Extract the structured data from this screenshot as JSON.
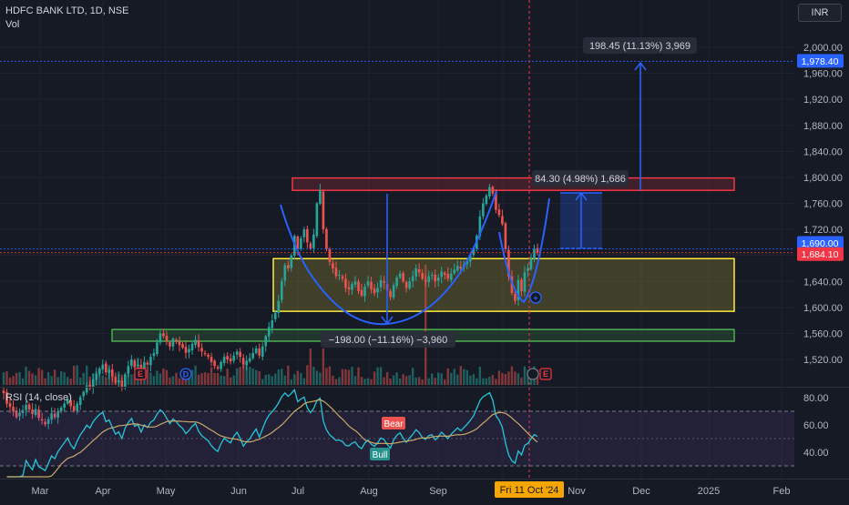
{
  "header": {
    "symbol_line": "HDFC BANK LTD, 1D, NSE",
    "volume_label": "Vol",
    "currency": "INR"
  },
  "rsi": {
    "label": "RSI (14, close)",
    "levels": [
      80.0,
      60.0,
      40.0
    ],
    "overbought": 70,
    "oversold": 30
  },
  "chart_data": [
    {
      "type": "candlestick",
      "title": "HDFC BANK LTD, 1D, NSE",
      "ylim": [
        1500,
        2030
      ],
      "y_ticks": [
        "1,520.00",
        "1,560.00",
        "1,600.00",
        "1,640.00",
        "1,680.00",
        "1,720.00",
        "1,760.00",
        "1,800.00",
        "1,840.00",
        "1,880.00",
        "1,920.00",
        "1,960.00",
        "2,000.00"
      ],
      "x_ticks": [
        "Mar",
        "Apr",
        "May",
        "Jun",
        "Jul",
        "Aug",
        "Sep",
        "Oct",
        "Nov",
        "Dec",
        "2025",
        "Feb"
      ],
      "price_labels": [
        {
          "value": 1978.4,
          "text": "1,978.40",
          "color": "#2962ff"
        },
        {
          "value": 1690.0,
          "text": "1,690.00",
          "color": "#2962ff"
        },
        {
          "value": 1684.1,
          "text": "1,684.10",
          "color": "#f23645"
        }
      ],
      "crosshair_date": "Fri 11 Oct '24",
      "zones": [
        {
          "name": "resistance",
          "from": 1780,
          "to": 1799,
          "color": "#f23645"
        },
        {
          "name": "range",
          "from": 1594,
          "to": 1675,
          "color": "#ffeb3b"
        },
        {
          "name": "support",
          "from": 1548,
          "to": 1566,
          "color": "#4caf50"
        }
      ],
      "annotations": [
        {
          "text": "198.45 (11.13%) 3,969"
        },
        {
          "text": "84.30 (4.98%) 1,686"
        },
        {
          "text": "−198.00 (−11.16%) −3,960"
        }
      ],
      "closes": [
        1468,
        1452,
        1447,
        1440,
        1431,
        1438,
        1442,
        1450,
        1443,
        1436,
        1444,
        1430,
        1426,
        1420,
        1428,
        1437,
        1431,
        1440,
        1446,
        1452,
        1459,
        1448,
        1441,
        1452,
        1462,
        1470,
        1480,
        1476,
        1489,
        1498,
        1506,
        1512,
        1500,
        1504,
        1494,
        1484,
        1488,
        1478,
        1497,
        1510,
        1520,
        1508,
        1512,
        1500,
        1516,
        1512,
        1524,
        1530,
        1546,
        1560,
        1556,
        1548,
        1540,
        1552,
        1548,
        1542,
        1538,
        1530,
        1536,
        1544,
        1550,
        1539,
        1532,
        1528,
        1524,
        1516,
        1510,
        1506,
        1516,
        1524,
        1520,
        1517,
        1526,
        1532,
        1524,
        1512,
        1518,
        1522,
        1530,
        1537,
        1526,
        1540,
        1556,
        1570,
        1580,
        1592,
        1610,
        1640,
        1665,
        1660,
        1680,
        1710,
        1690,
        1706,
        1720,
        1700,
        1690,
        1712,
        1760,
        1780,
        1720,
        1690,
        1670,
        1660,
        1648,
        1650,
        1644,
        1630,
        1628,
        1636,
        1640,
        1625,
        1618,
        1632,
        1640,
        1628,
        1622,
        1630,
        1642,
        1638,
        1626,
        1616,
        1634,
        1646,
        1652,
        1640,
        1630,
        1640,
        1648,
        1660,
        1654,
        1644,
        1640,
        1648,
        1650,
        1640,
        1646,
        1655,
        1650,
        1644,
        1652,
        1658,
        1664,
        1660,
        1666,
        1672,
        1680,
        1690,
        1710,
        1740,
        1760,
        1772,
        1785,
        1775,
        1750,
        1742,
        1728,
        1690,
        1648,
        1622,
        1610,
        1642,
        1625,
        1654,
        1660,
        1675,
        1690,
        1684
      ],
      "ohlc_shown": "OHLC candles are generated from the closes above",
      "volumes": "relative volume per candle shown as histogram at the base of the price pane"
    },
    {
      "type": "line",
      "title": "RSI (14, close)",
      "ylim": [
        20,
        90
      ],
      "y_ticks": [
        "80.00",
        "60.00",
        "40.00"
      ],
      "series": [
        {
          "name": "RSI",
          "color": "#26c6da"
        },
        {
          "name": "RSI-based MA",
          "color": "#c8a96a"
        }
      ],
      "labels": [
        "Bear",
        "Bull"
      ]
    }
  ]
}
